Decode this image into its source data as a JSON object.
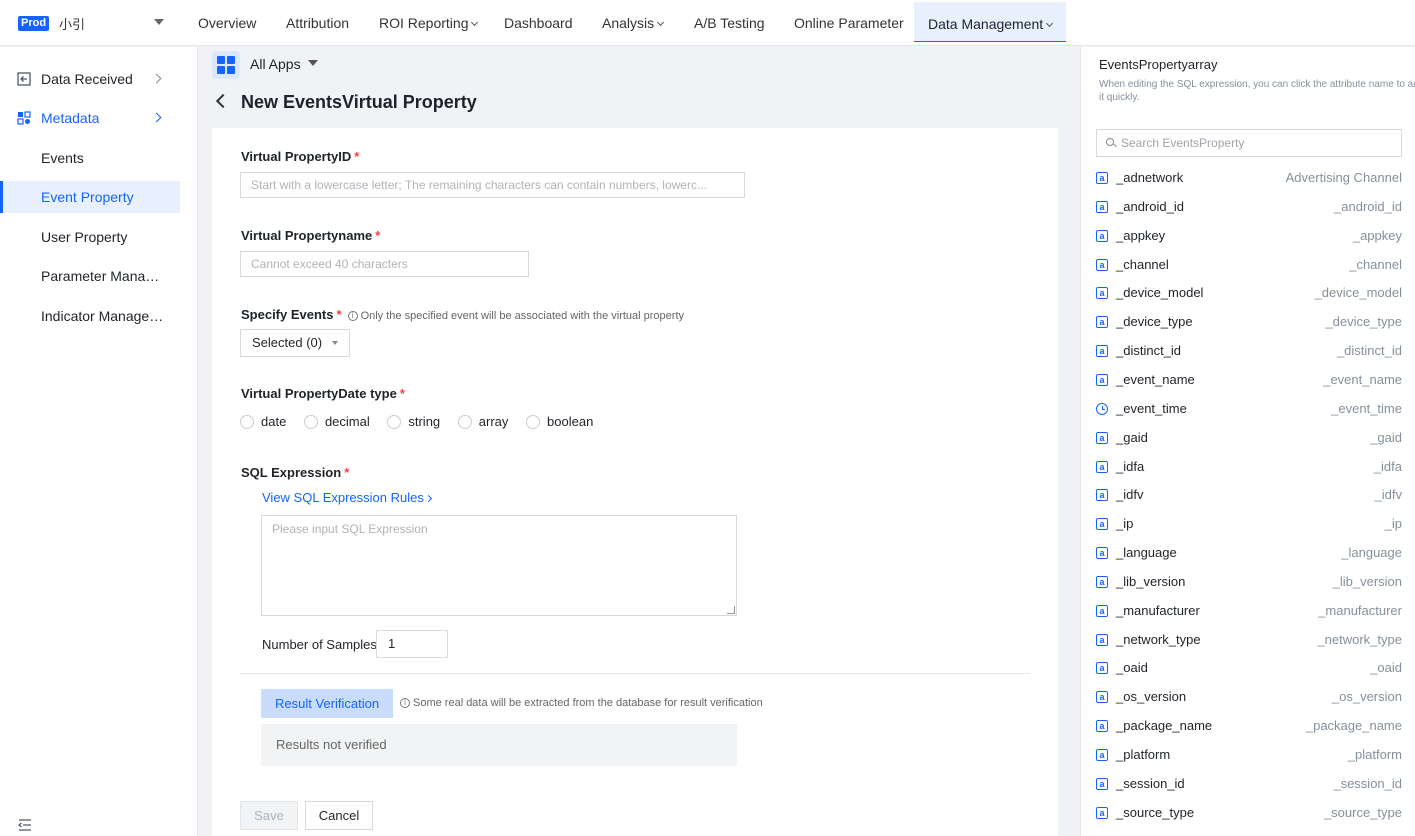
{
  "topbar": {
    "env_badge": "Prod",
    "app_name": "小引",
    "nav": [
      {
        "label": "Overview",
        "has_dropdown": false
      },
      {
        "label": "Attribution",
        "has_dropdown": false
      },
      {
        "label": "ROI Reporting",
        "has_dropdown": true
      },
      {
        "label": "Dashboard",
        "has_dropdown": false
      },
      {
        "label": "Analysis",
        "has_dropdown": true
      },
      {
        "label": "A/B Testing",
        "has_dropdown": false
      },
      {
        "label": "Online Parameter",
        "has_dropdown": false
      },
      {
        "label": "Data Management",
        "has_dropdown": true,
        "active": true
      }
    ]
  },
  "sidebar": {
    "items": [
      {
        "label": "Data Received",
        "icon": "data-received-icon",
        "has_arrow": true
      },
      {
        "label": "Metadata",
        "icon": "metadata-icon",
        "has_arrow": true,
        "highlighted": true
      },
      {
        "label": "Events"
      },
      {
        "label": "Event Property",
        "active": true
      },
      {
        "label": "User Property"
      },
      {
        "label": "Parameter Manage..."
      },
      {
        "label": "Indicator Managem..."
      }
    ]
  },
  "main": {
    "app_selector": "All Apps",
    "page_title": "New EventsVirtual Property",
    "form": {
      "property_id_label": "Virtual PropertyID",
      "property_id_placeholder": "Start with a lowercase letter; The remaining characters can contain numbers, lowerc...",
      "property_name_label": "Virtual Propertyname",
      "property_name_placeholder": "Cannot exceed 40 characters",
      "specify_events_label": "Specify Events",
      "specify_events_hint": "Only the specified event will be associated with the virtual property",
      "specify_events_value": "Selected (0)",
      "date_type_label": "Virtual PropertyDate type",
      "date_types": [
        "date",
        "decimal",
        "string",
        "array",
        "boolean"
      ],
      "sql_label": "SQL Expression",
      "sql_rules_link": "View SQL Expression Rules",
      "sql_placeholder": "Please input SQL Expression",
      "samples_label": "Number of Samples",
      "samples_value": "1",
      "verify_button": "Result Verification",
      "verify_hint": "Some real data will be extracted from the database for result verification",
      "result_text": "Results not verified",
      "save_button": "Save",
      "cancel_button": "Cancel"
    }
  },
  "right_panel": {
    "title": "EventsPropertyarray",
    "description": "When editing the SQL expression, you can click the attribute name to add it quickly.",
    "search_placeholder": "Search EventsProperty",
    "properties": [
      {
        "name": "_adnetwork",
        "alias": "Advertising Channel",
        "icon": "text"
      },
      {
        "name": "_android_id",
        "alias": "_android_id",
        "icon": "text"
      },
      {
        "name": "_appkey",
        "alias": "_appkey",
        "icon": "text"
      },
      {
        "name": "_channel",
        "alias": "_channel",
        "icon": "text"
      },
      {
        "name": "_device_model",
        "alias": "_device_model",
        "icon": "text"
      },
      {
        "name": "_device_type",
        "alias": "_device_type",
        "icon": "text"
      },
      {
        "name": "_distinct_id",
        "alias": "_distinct_id",
        "icon": "text"
      },
      {
        "name": "_event_name",
        "alias": "_event_name",
        "icon": "text"
      },
      {
        "name": "_event_time",
        "alias": "_event_time",
        "icon": "clock"
      },
      {
        "name": "_gaid",
        "alias": "_gaid",
        "icon": "text"
      },
      {
        "name": "_idfa",
        "alias": "_idfa",
        "icon": "text"
      },
      {
        "name": "_idfv",
        "alias": "_idfv",
        "icon": "text"
      },
      {
        "name": "_ip",
        "alias": "_ip",
        "icon": "text"
      },
      {
        "name": "_language",
        "alias": "_language",
        "icon": "text"
      },
      {
        "name": "_lib_version",
        "alias": "_lib_version",
        "icon": "text"
      },
      {
        "name": "_manufacturer",
        "alias": "_manufacturer",
        "icon": "text"
      },
      {
        "name": "_network_type",
        "alias": "_network_type",
        "icon": "text"
      },
      {
        "name": "_oaid",
        "alias": "_oaid",
        "icon": "text"
      },
      {
        "name": "_os_version",
        "alias": "_os_version",
        "icon": "text"
      },
      {
        "name": "_package_name",
        "alias": "_package_name",
        "icon": "text"
      },
      {
        "name": "_platform",
        "alias": "_platform",
        "icon": "text"
      },
      {
        "name": "_session_id",
        "alias": "_session_id",
        "icon": "text"
      },
      {
        "name": "_source_type",
        "alias": "_source_type",
        "icon": "text"
      }
    ]
  },
  "colors": {
    "accent": "#1664ff",
    "required": "#f53f3f"
  }
}
